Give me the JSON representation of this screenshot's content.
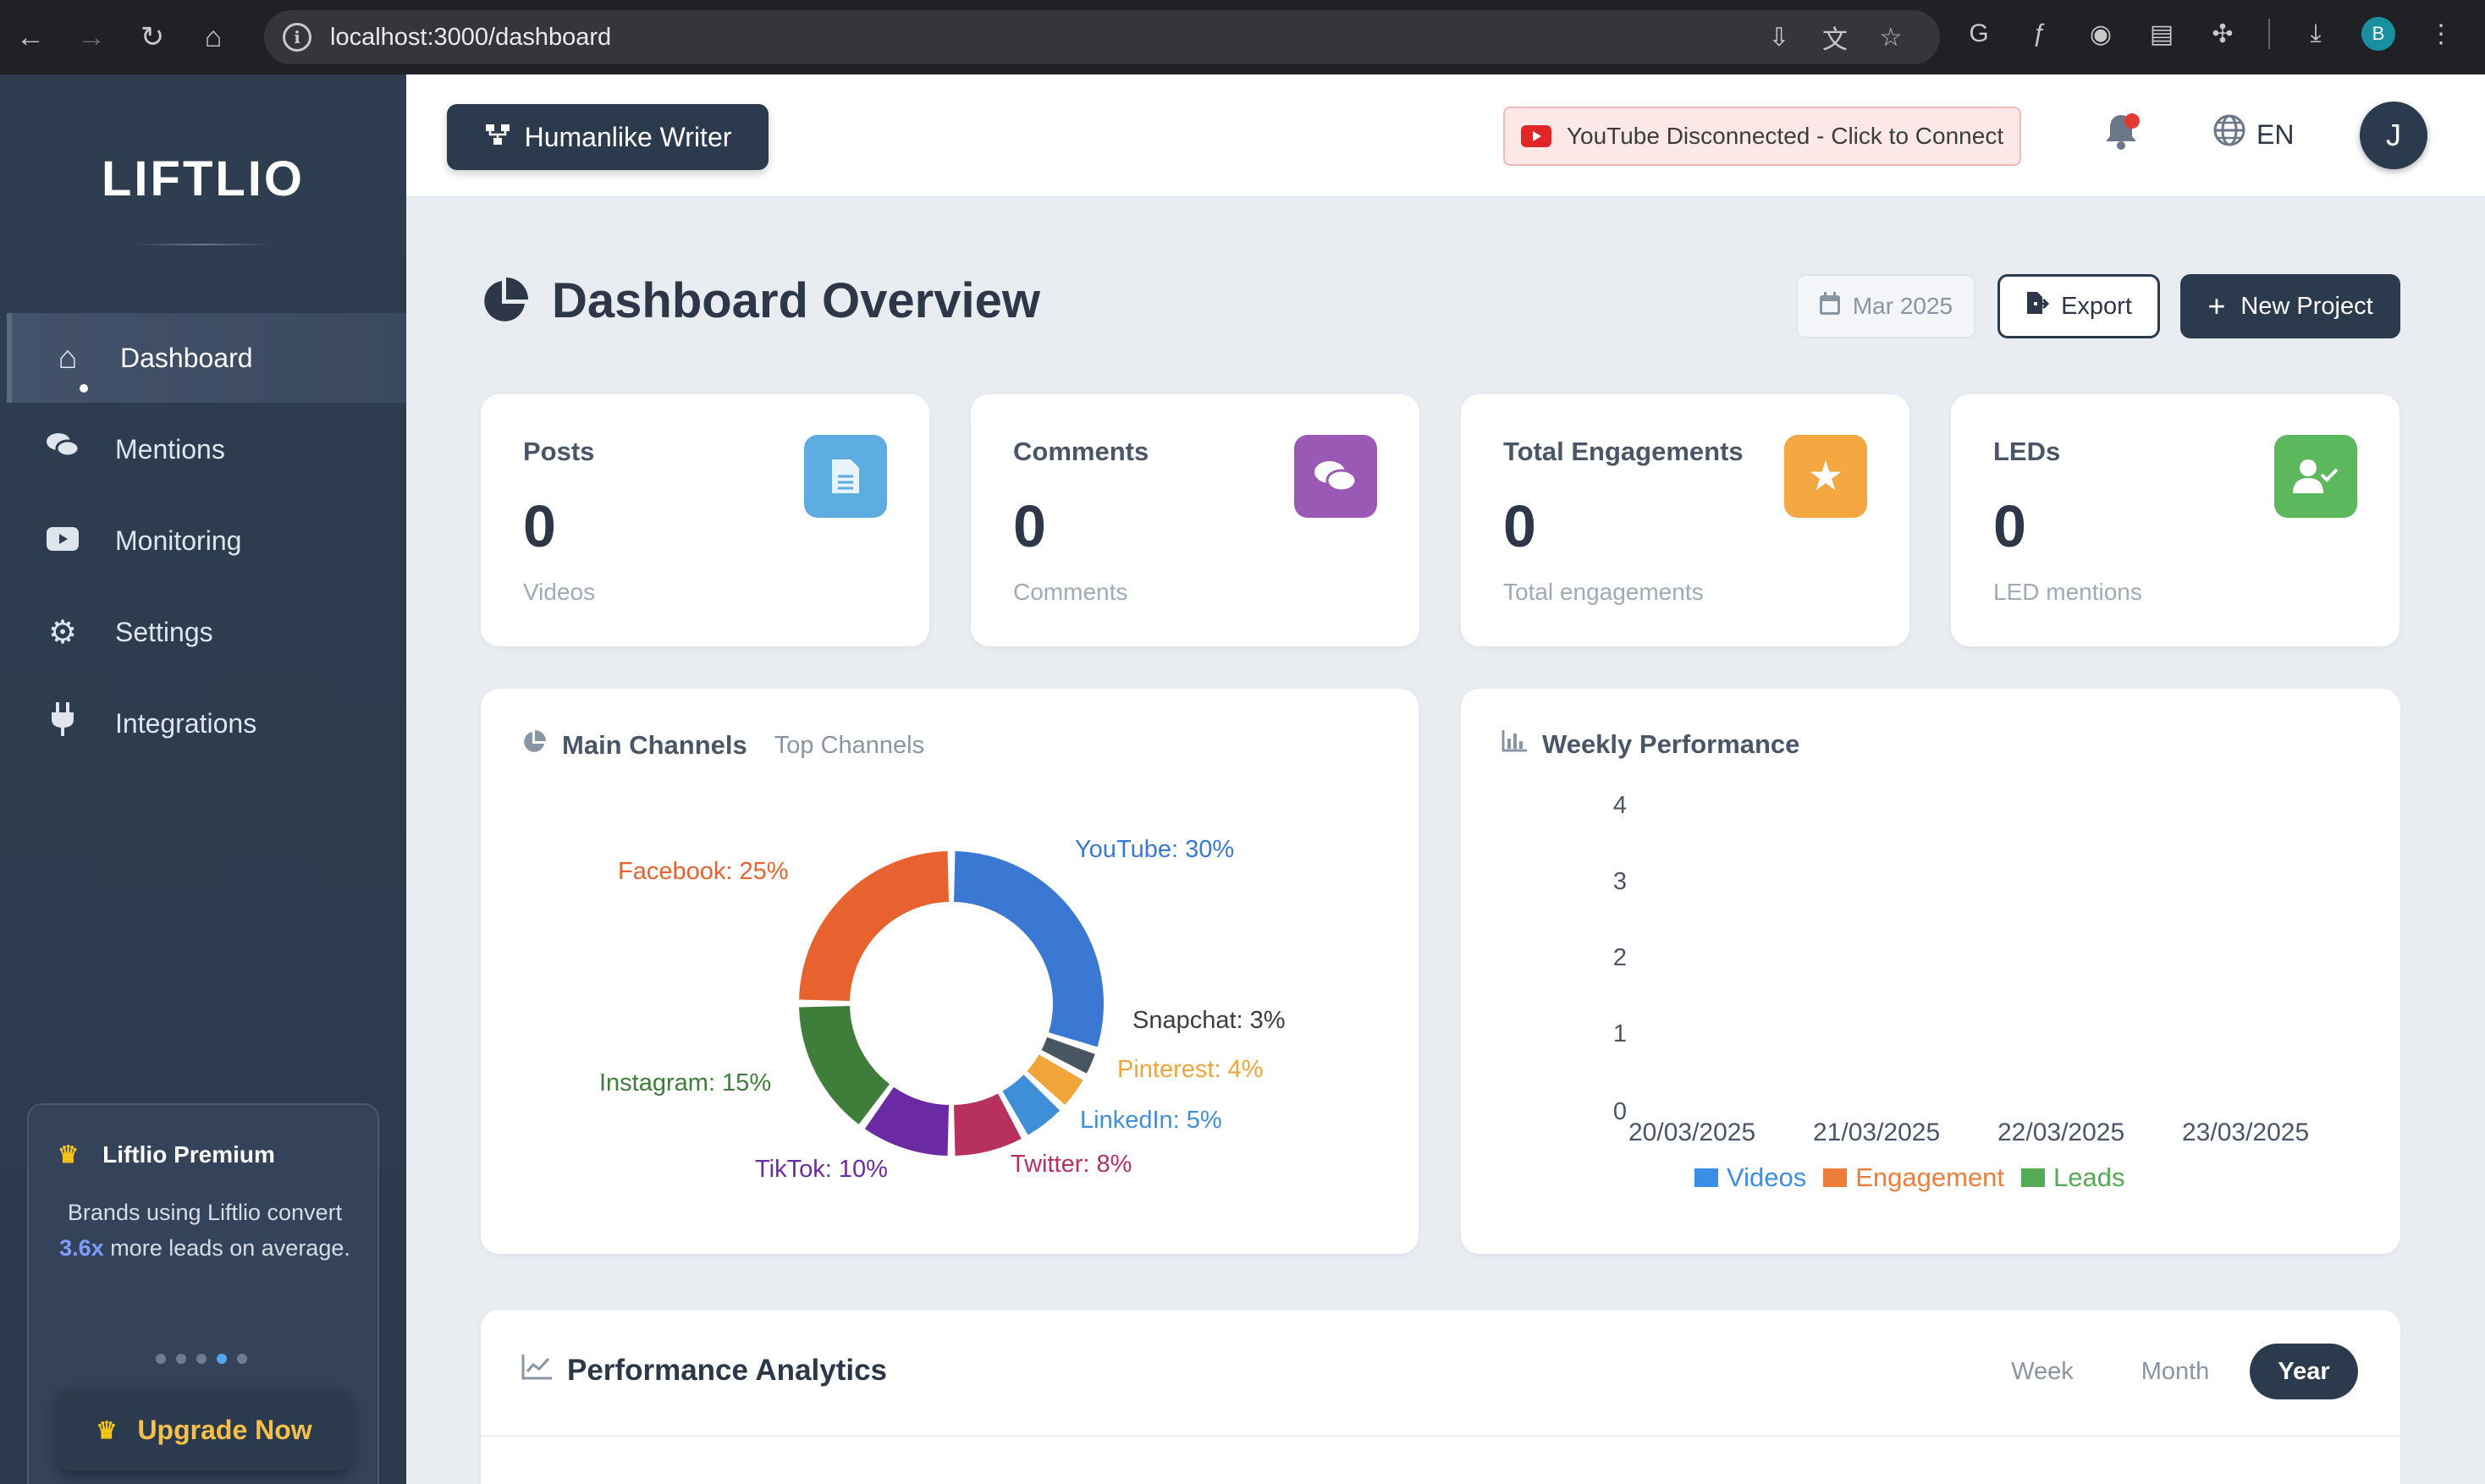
{
  "browser": {
    "url": "localhost:3000/dashboard",
    "profile_initial": "B"
  },
  "sidebar": {
    "logo": "LIFTLIO",
    "items": [
      {
        "label": "Dashboard",
        "icon": "home-icon"
      },
      {
        "label": "Mentions",
        "icon": "comments-icon"
      },
      {
        "label": "Monitoring",
        "icon": "youtube-icon"
      },
      {
        "label": "Settings",
        "icon": "gear-icon"
      },
      {
        "label": "Integrations",
        "icon": "plug-icon"
      }
    ],
    "premium": {
      "title": "Liftlio Premium",
      "text_before": "Brands using Liftlio convert ",
      "highlight": "3.6x",
      "text_after": " more leads on average.",
      "upgrade_label": "Upgrade Now"
    }
  },
  "header": {
    "writer_button": "Humanlike Writer",
    "youtube_status": "YouTube Disconnected - Click to Connect",
    "language": "EN",
    "avatar_initial": "J"
  },
  "page": {
    "title": "Dashboard Overview",
    "date_filter": "Mar 2025",
    "export_label": "Export",
    "new_project_label": "New Project"
  },
  "stats": [
    {
      "label": "Posts",
      "value": "0",
      "sub": "Videos",
      "icon": "document-icon",
      "color": "#5dade2"
    },
    {
      "label": "Comments",
      "value": "0",
      "sub": "Comments",
      "icon": "comments-icon",
      "color": "#9b59b6"
    },
    {
      "label": "Total Engagements",
      "value": "0",
      "sub": "Total engagements",
      "icon": "star-icon",
      "color": "#f5a742"
    },
    {
      "label": "LEDs",
      "value": "0",
      "sub": "LED mentions",
      "icon": "user-check-icon",
      "color": "#5cb85c"
    }
  ],
  "channels_panel": {
    "title": "Main Channels",
    "subtitle": "Top Channels"
  },
  "weekly_panel": {
    "title": "Weekly Performance"
  },
  "analytics_panel": {
    "title": "Performance Analytics",
    "tabs": [
      "Week",
      "Month",
      "Year"
    ],
    "active_tab": "Year"
  },
  "chart_data": [
    {
      "type": "pie",
      "title": "",
      "donut": true,
      "slices": [
        {
          "label": "YouTube: 30%",
          "name": "YouTube",
          "value": 30,
          "color": "#3a78d4"
        },
        {
          "label": "Snapchat: 3%",
          "name": "Snapchat",
          "value": 3,
          "color": "#4a5562"
        },
        {
          "label": "Pinterest: 4%",
          "name": "Pinterest",
          "value": 4,
          "color": "#f0a43a"
        },
        {
          "label": "LinkedIn: 5%",
          "name": "LinkedIn",
          "value": 5,
          "color": "#3f8fd8"
        },
        {
          "label": "Twitter: 8%",
          "name": "Twitter",
          "value": 8,
          "color": "#b8305e"
        },
        {
          "label": "TikTok: 10%",
          "name": "TikTok",
          "value": 10,
          "color": "#6b2aa3"
        },
        {
          "label": "Instagram: 15%",
          "name": "Instagram",
          "value": 15,
          "color": "#3f7d3a"
        },
        {
          "label": "Facebook: 25%",
          "name": "Facebook",
          "value": 25,
          "color": "#e8622f"
        }
      ]
    },
    {
      "type": "bar",
      "title": "",
      "categories": [
        "20/03/2025",
        "21/03/2025",
        "22/03/2025",
        "23/03/2025"
      ],
      "series": [
        {
          "name": "Videos",
          "values": [
            0,
            0,
            0,
            0
          ],
          "color": "#3a8ee6"
        },
        {
          "name": "Engagement",
          "values": [
            0,
            0,
            0,
            0
          ],
          "color": "#ec7e3a"
        },
        {
          "name": "Leads",
          "values": [
            0,
            0,
            0,
            0
          ],
          "color": "#55aa55"
        }
      ],
      "ylim": [
        0,
        4
      ],
      "yticks": [
        "0",
        "1",
        "2",
        "3",
        "4"
      ],
      "grid": false,
      "legend": "bottom"
    }
  ]
}
